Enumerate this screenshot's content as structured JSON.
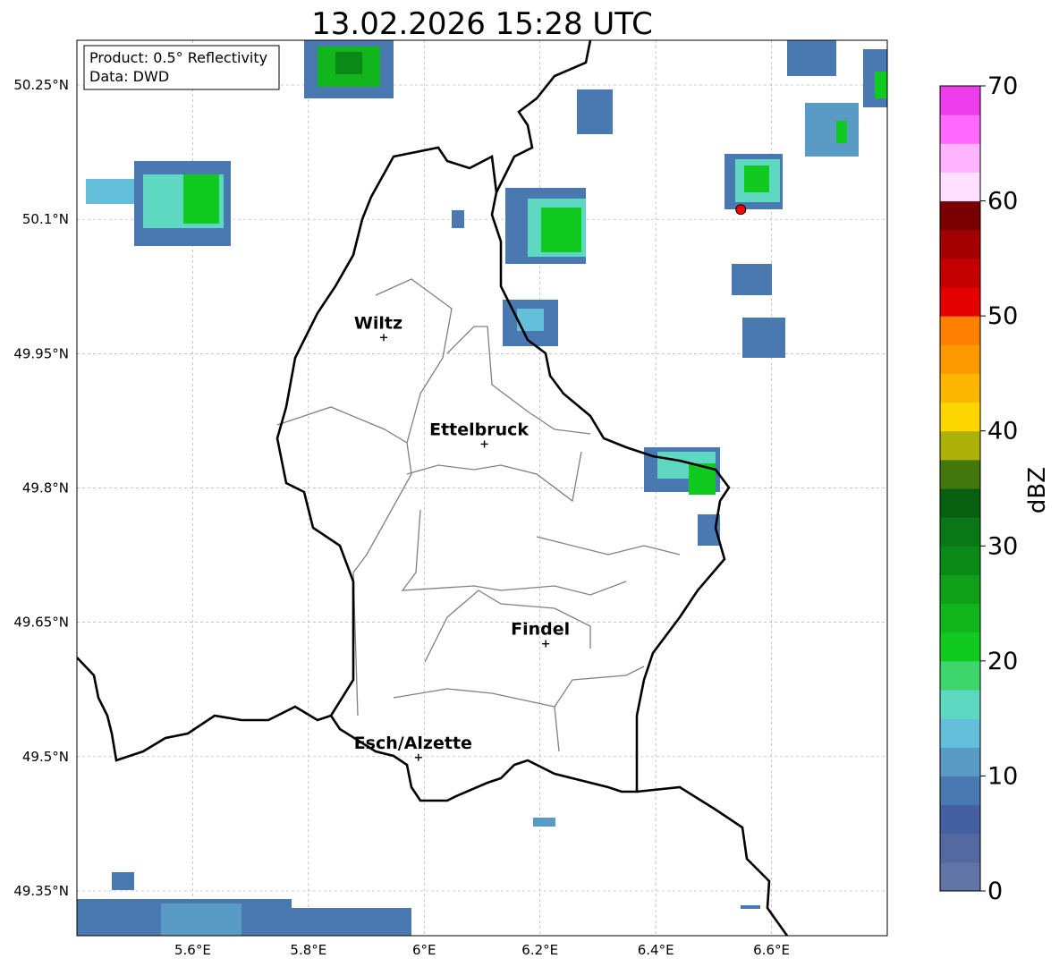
{
  "title": "13.02.2026 15:28 UTC",
  "info_box": {
    "product_line": "Product: 0.5° Reflectivity",
    "data_line": "Data: DWD"
  },
  "map": {
    "lon_range": [
      5.4,
      6.8
    ],
    "lat_range": [
      49.3,
      50.3
    ],
    "lon_ticks": [
      {
        "value": 5.6,
        "label": "5.6°E"
      },
      {
        "value": 5.8,
        "label": "5.8°E"
      },
      {
        "value": 6.0,
        "label": "6°E"
      },
      {
        "value": 6.2,
        "label": "6.2°E"
      },
      {
        "value": 6.4,
        "label": "6.4°E"
      },
      {
        "value": 6.6,
        "label": "6.6°E"
      }
    ],
    "lat_ticks": [
      {
        "value": 50.25,
        "label": "50.25°N"
      },
      {
        "value": 50.1,
        "label": "50.1°N"
      },
      {
        "value": 49.95,
        "label": "49.95°N"
      },
      {
        "value": 49.8,
        "label": "49.8°N"
      },
      {
        "value": 49.65,
        "label": "49.65°N"
      },
      {
        "value": 49.5,
        "label": "49.5°N"
      },
      {
        "value": 49.35,
        "label": "49.35°N"
      }
    ],
    "gridlines": true,
    "cities": [
      {
        "name": "Wiltz",
        "lon": 5.93,
        "lat": 49.968
      },
      {
        "name": "Ettelbruck",
        "lon": 6.104,
        "lat": 49.849
      },
      {
        "name": "Findel",
        "lon": 6.21,
        "lat": 49.626
      },
      {
        "name": "Esch/Alzette",
        "lon": 5.99,
        "lat": 49.499
      }
    ],
    "radar_site": {
      "lon": 6.547,
      "lat": 50.111,
      "color": "#ff0000"
    }
  },
  "colorbar": {
    "label": "dBZ",
    "min": 0,
    "max": 70,
    "step": 2.5,
    "tick_values": [
      0,
      10,
      20,
      30,
      40,
      50,
      60,
      70
    ],
    "colors": [
      "#6273a6",
      "#53699f",
      "#4460a0",
      "#4a79b1",
      "#5a9bc6",
      "#64c0da",
      "#5fd8c2",
      "#3ed56c",
      "#11ca20",
      "#11b51c",
      "#0f9f18",
      "#0b8917",
      "#097716",
      "#075f10",
      "#44760e",
      "#adb209",
      "#fdd600",
      "#fdb600",
      "#fd9900",
      "#fe7f00",
      "#e50000",
      "#c30000",
      "#a40000",
      "#7a0000",
      "#ffe0ff",
      "#ffb4ff",
      "#ff69ff",
      "#ec3cec"
    ]
  }
}
